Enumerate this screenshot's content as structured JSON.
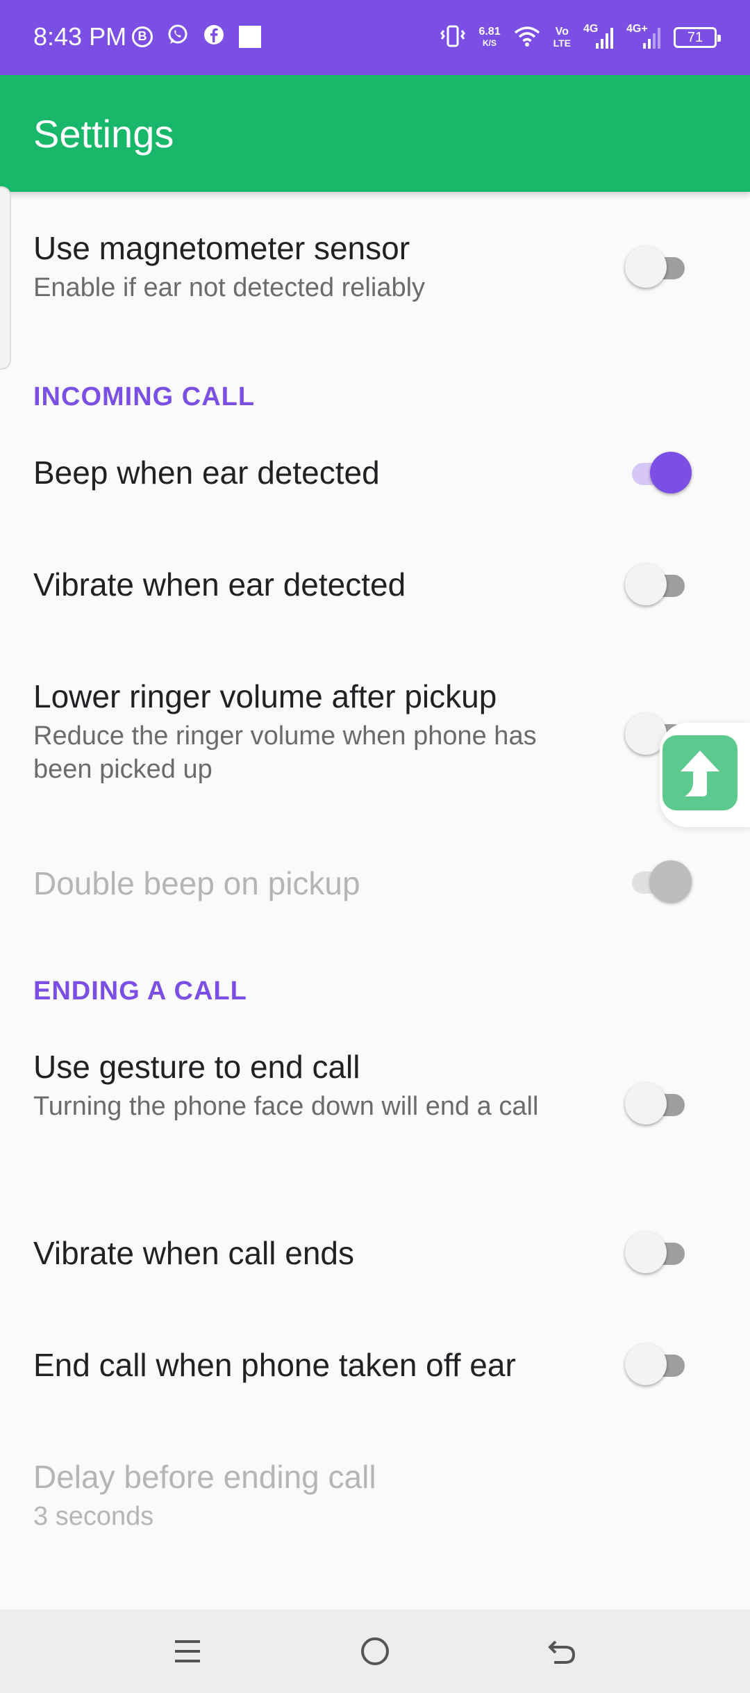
{
  "status_bar": {
    "time": "8:43 PM",
    "icons_left": [
      "b-circle-icon",
      "whatsapp-icon",
      "facebook-icon",
      "square-icon"
    ],
    "net_speed_value": "6.81",
    "net_speed_unit": "K/S",
    "volte_top": "Vo",
    "volte_bottom": "LTE",
    "sim1_label": "4G",
    "sim2_label": "4G+",
    "battery": "71"
  },
  "app_bar": {
    "title": "Settings"
  },
  "settings": {
    "magnetometer": {
      "title": "Use magnetometer sensor",
      "summary": "Enable if ear not detected reliably",
      "checked": false
    },
    "incoming_header": "INCOMING CALL",
    "beep": {
      "title": "Beep when ear detected",
      "checked": true
    },
    "vibrate_detect": {
      "title": "Vibrate when ear detected",
      "checked": false
    },
    "lower_ringer": {
      "title": "Lower ringer volume after pickup",
      "summary": "Reduce the ringer volume when phone has been picked up",
      "checked": false
    },
    "double_beep": {
      "title": "Double beep on pickup",
      "checked": true,
      "enabled": false
    },
    "ending_header": "ENDING A CALL",
    "gesture_end": {
      "title": "Use gesture to end call",
      "summary": "Turning the phone face down will end a call",
      "checked": false
    },
    "vibrate_end": {
      "title": "Vibrate when call ends",
      "checked": false
    },
    "end_off_ear": {
      "title": "End call when phone taken off ear",
      "checked": false
    },
    "delay": {
      "title": "Delay before ending call",
      "summary": "3 seconds",
      "enabled": false
    }
  },
  "colors": {
    "status_bar": "#7b4fe4",
    "app_bar": "#18b76a",
    "accent": "#7b4fe4",
    "float_button": "#5cc98f"
  },
  "nav_bar": {
    "icons": [
      "menu-icon",
      "home-icon",
      "back-icon"
    ]
  }
}
